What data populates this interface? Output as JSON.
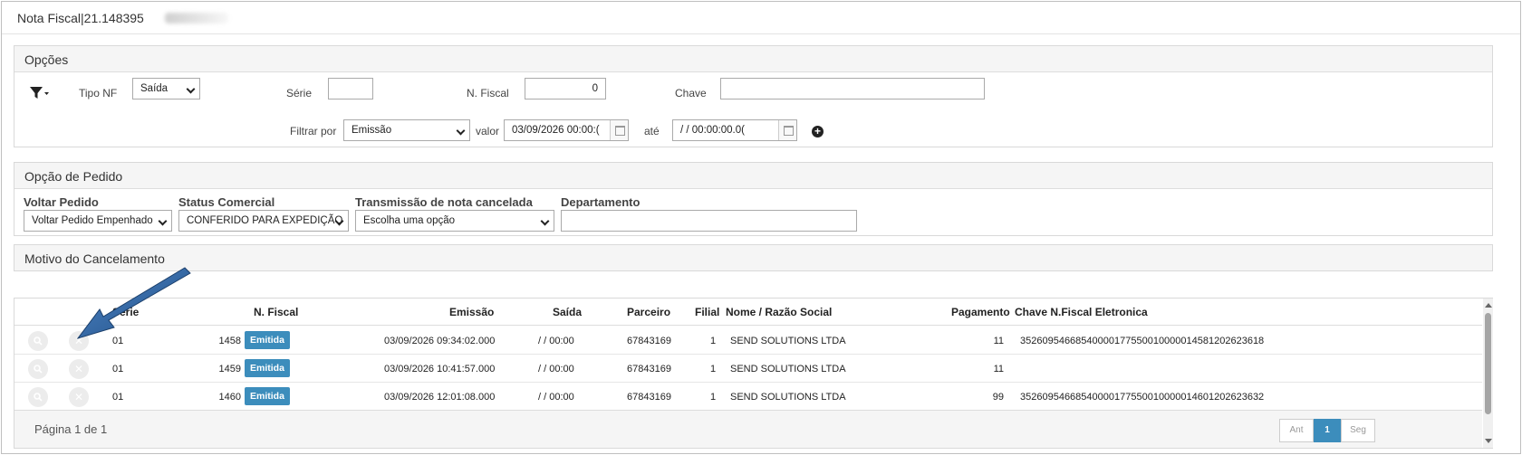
{
  "window": {
    "title": "Nota Fiscal|21.148395"
  },
  "opcoes": {
    "header": "Opções",
    "tipo_nf_label": "Tipo NF",
    "tipo_nf_value": "Saída",
    "serie_label": "Série",
    "serie_value": "",
    "nfiscal_label": "N. Fiscal",
    "nfiscal_value": "0",
    "chave_label": "Chave",
    "chave_value": "",
    "filtrar_label": "Filtrar por",
    "filtrar_value": "Emissão",
    "valor_label": "valor",
    "valor_value": "03/09/2026 00:00:(",
    "ate_label": "até",
    "ate_value": "/ /      00:00:00.0("
  },
  "pedido": {
    "header": "Opção de Pedido",
    "voltar_label": "Voltar Pedido",
    "voltar_value": "Voltar Pedido Empenhado",
    "status_label": "Status Comercial",
    "status_value": "CONFERIDO PARA EXPEDIÇÃO",
    "transmissao_label": "Transmissão de nota cancelada",
    "transmissao_value": "Escolha uma opção",
    "departamento_label": "Departamento",
    "departamento_value": ""
  },
  "motivo": {
    "header": "Motivo do Cancelamento"
  },
  "table": {
    "columns": {
      "serie": "Série",
      "nfiscal": "N. Fiscal",
      "emissao": "Emissão",
      "saida": "Saída",
      "parceiro": "Parceiro",
      "filial": "Filial",
      "nome": "Nome / Razão Social",
      "pagamento": "Pagamento",
      "chave": "Chave N.Fiscal Eletronica"
    },
    "rows": [
      {
        "serie": "01",
        "nfiscal": "1458",
        "status": "Emitida",
        "emissao": "03/09/2026 09:34:02.000",
        "saida": "/ / 00:00",
        "parceiro": "67843169",
        "filial": "1",
        "nome": "SEND SOLUTIONS LTDA",
        "pagamento": "11",
        "chave": "35260954668540000177550010000014581202623618"
      },
      {
        "serie": "01",
        "nfiscal": "1459",
        "status": "Emitida",
        "emissao": "03/09/2026 10:41:57.000",
        "saida": "/ / 00:00",
        "parceiro": "67843169",
        "filial": "1",
        "nome": "SEND SOLUTIONS LTDA",
        "pagamento": "11",
        "chave": ""
      },
      {
        "serie": "01",
        "nfiscal": "1460",
        "status": "Emitida",
        "emissao": "03/09/2026 12:01:08.000",
        "saida": "/ / 00:00",
        "parceiro": "67843169",
        "filial": "1",
        "nome": "SEND SOLUTIONS LTDA",
        "pagamento": "99",
        "chave": "35260954668540000177550010000014601202623632"
      }
    ]
  },
  "footer": {
    "page_info": "Página 1 de 1",
    "prev": "Ant",
    "current": "1",
    "next": "Seg"
  },
  "icons": {
    "filter": "filter-icon",
    "add": "plus-circle-icon",
    "view": "search-icon",
    "cancel": "close-icon",
    "calendar": "calendar-icon",
    "annotation": "arrow-icon"
  },
  "colors": {
    "badge": "#3c8dbc",
    "arrow": "#2a5d94"
  }
}
